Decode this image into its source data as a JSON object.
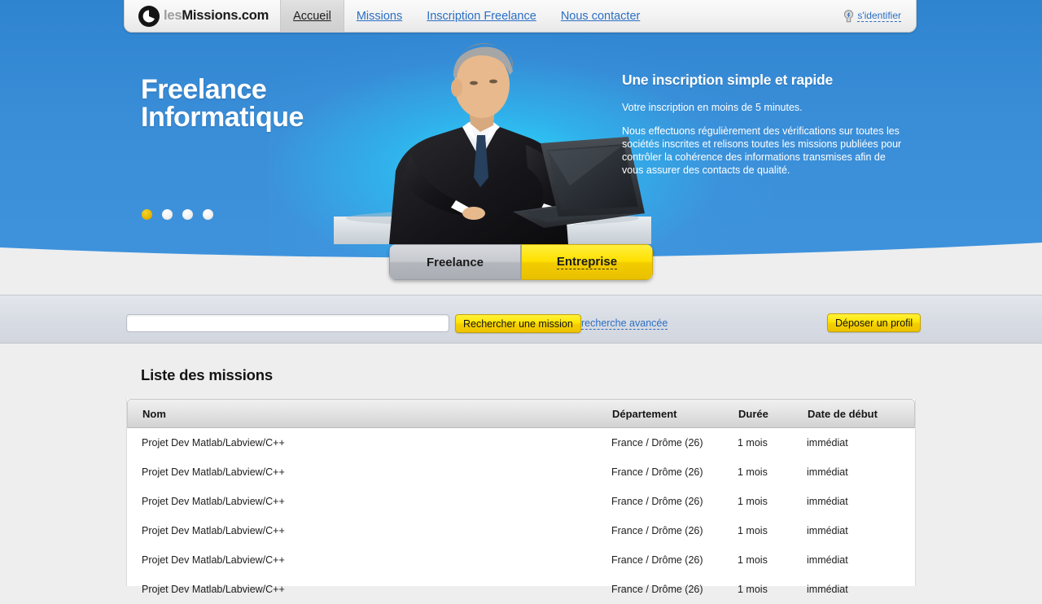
{
  "header": {
    "logo": {
      "icon": "circle-e-logo-icon",
      "prefix": "les",
      "suffix": "Missions.com"
    },
    "nav": [
      {
        "label": "Accueil",
        "active": true
      },
      {
        "label": "Missions",
        "active": false
      },
      {
        "label": "Inscription Freelance",
        "active": false
      },
      {
        "label": "Nous contacter",
        "active": false
      }
    ],
    "login": {
      "icon": "key-icon",
      "label": "s'identifier"
    }
  },
  "hero": {
    "title_line1": "Freelance",
    "title_line2": "Informatique",
    "subtitle": "Une inscription simple et rapide",
    "lead": "Votre inscription en moins de 5 minutes.",
    "body": "Nous effectuons régulièrement des vérifications sur toutes les sociétés inscrites et relisons toutes les missions publiées pour contrôler la cohérence des informations transmises afin de vous assurer des contacts de qualité.",
    "carousel": {
      "total": 4,
      "active_index": 0
    }
  },
  "toggle": {
    "freelance_label": "Freelance",
    "entreprise_label": "Entreprise",
    "selected": "Freelance"
  },
  "search": {
    "value": "",
    "placeholder": "",
    "submit_label": "Rechercher une mission",
    "advanced_label": "recherche avancée",
    "deposit_label": "Déposer un profil"
  },
  "missions": {
    "section_title": "Liste des missions",
    "columns": [
      "Nom",
      "Département",
      "Durée",
      "Date de début"
    ],
    "rows": [
      {
        "nom": "Projet Dev Matlab/Labview/C++",
        "departement": "France / Drôme (26)",
        "duree": "1 mois",
        "date": "immédiat"
      },
      {
        "nom": "Projet Dev Matlab/Labview/C++",
        "departement": "France / Drôme (26)",
        "duree": "1 mois",
        "date": "immédiat"
      },
      {
        "nom": "Projet Dev Matlab/Labview/C++",
        "departement": "France / Drôme (26)",
        "duree": "1 mois",
        "date": "immédiat"
      },
      {
        "nom": "Projet Dev Matlab/Labview/C++",
        "departement": "France / Drôme (26)",
        "duree": "1 mois",
        "date": "immédiat"
      },
      {
        "nom": "Projet Dev Matlab/Labview/C++",
        "departement": "France / Drôme (26)",
        "duree": "1 mois",
        "date": "immédiat"
      },
      {
        "nom": "Projet Dev Matlab/Labview/C++",
        "departement": "France / Drôme (26)",
        "duree": "1 mois",
        "date": "immédiat"
      }
    ]
  },
  "colors": {
    "hero_blue": "#3a8ed8",
    "accent_yellow": "#ffe400",
    "link_blue": "#2b6fc4"
  }
}
